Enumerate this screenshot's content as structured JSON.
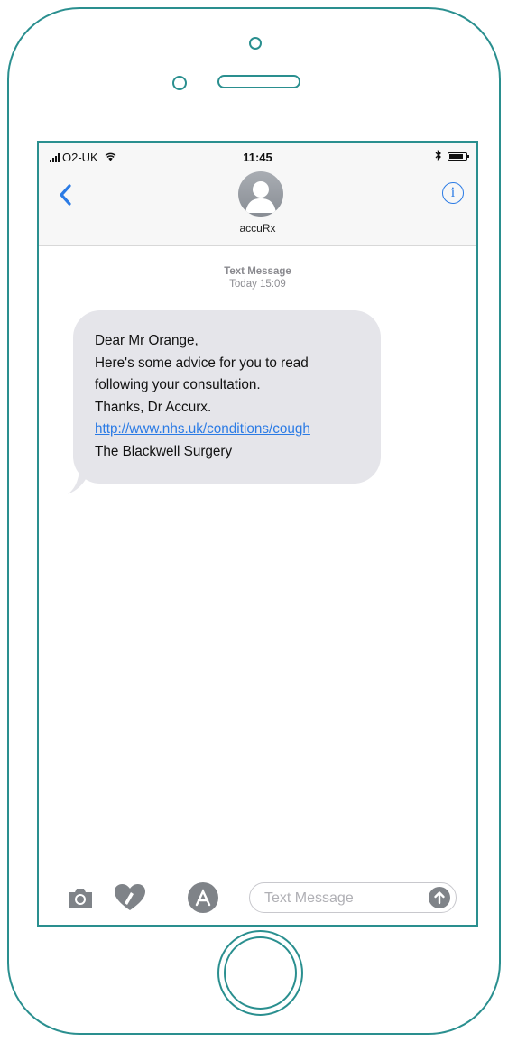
{
  "status_bar": {
    "carrier": "O2-UK",
    "time": "11:45"
  },
  "nav": {
    "contact_name": "accuRx",
    "back_icon": "chevron-left-icon",
    "info_icon": "info-icon"
  },
  "conversation": {
    "meta_label": "Text Message",
    "meta_time": "Today 15:09",
    "message": {
      "line1": "Dear Mr Orange,",
      "line2": "Here's some advice for you to read",
      "line3": "following your consultation.",
      "line4": "Thanks, Dr Accurx.",
      "link": "http://www.nhs.uk/conditions/cough",
      "line6": "The Blackwell Surgery"
    }
  },
  "input_bar": {
    "placeholder": "Text Message",
    "icons": [
      "camera-icon",
      "digital-touch-icon",
      "app-store-icon",
      "send-arrow-icon"
    ]
  },
  "colors": {
    "frame": "#2a8f8f",
    "accent": "#2b7be5",
    "bubble": "#e5e5ea"
  }
}
